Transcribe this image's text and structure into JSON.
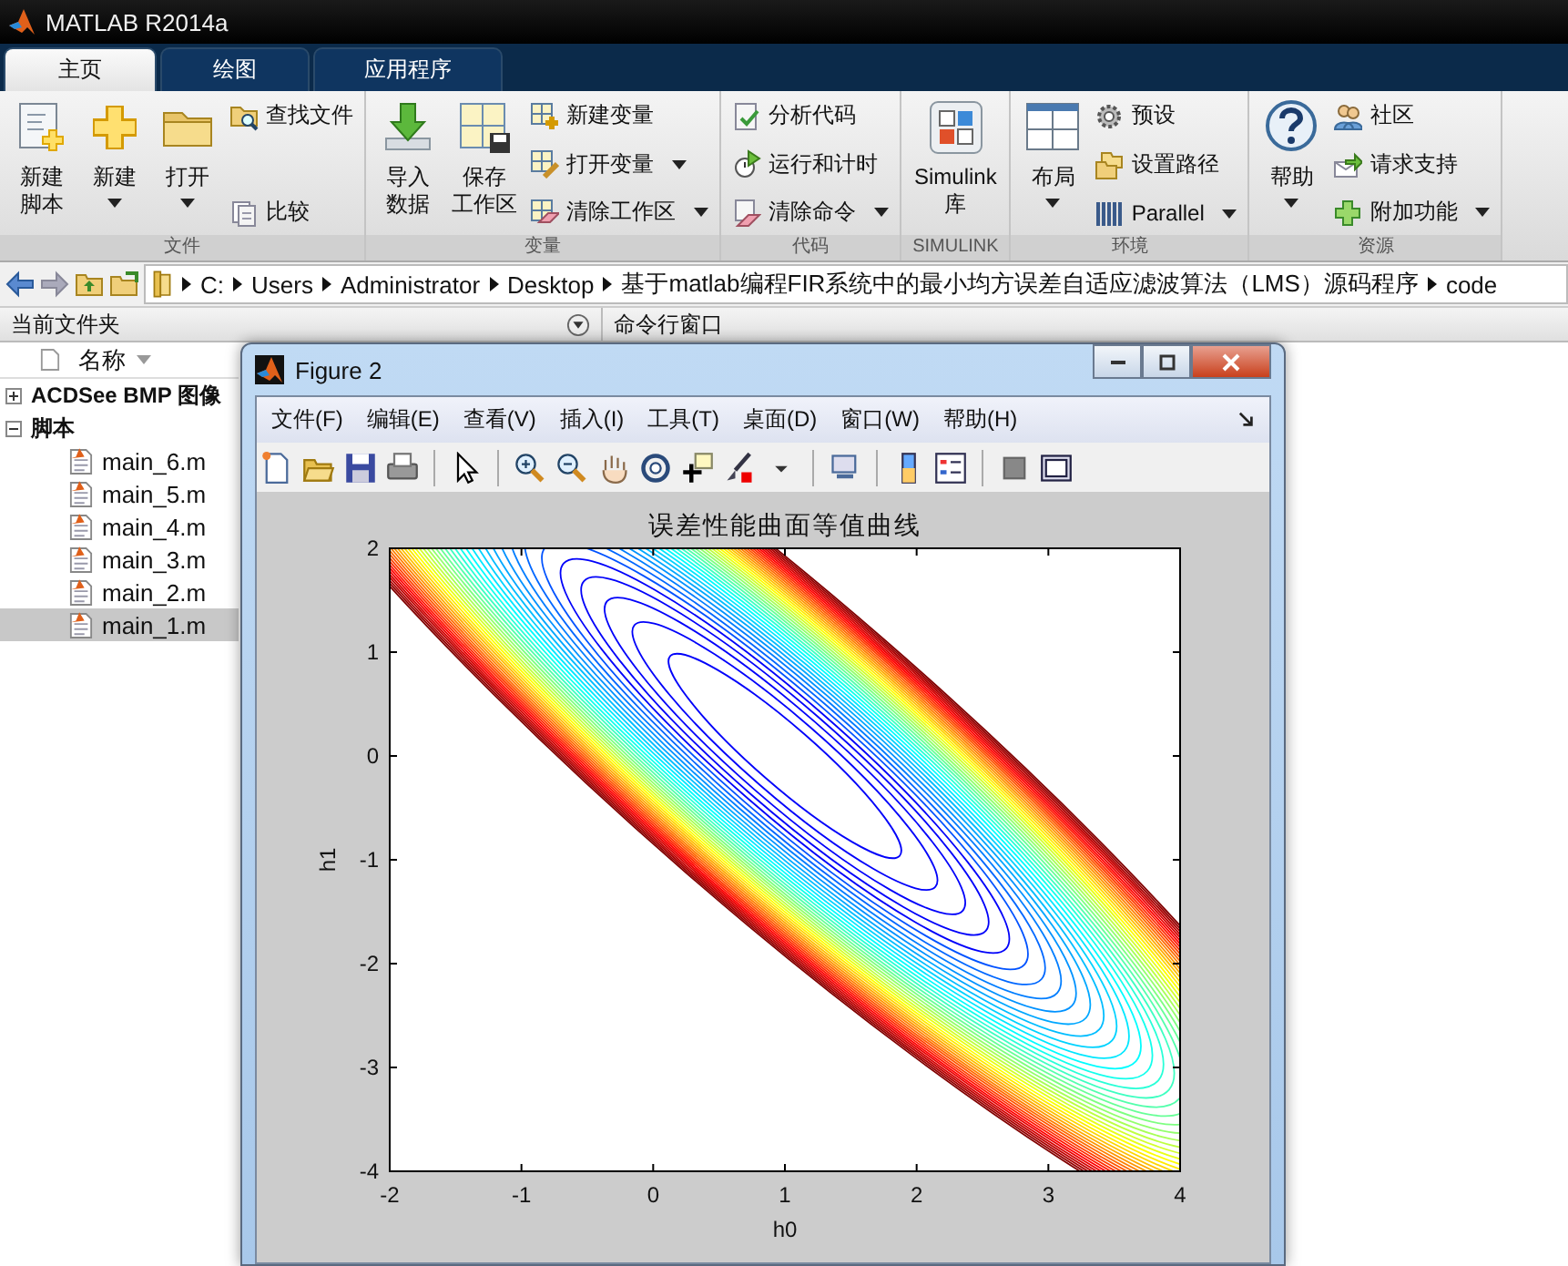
{
  "window": {
    "title": "MATLAB R2014a"
  },
  "tabs": [
    {
      "label": "主页",
      "selected": true
    },
    {
      "label": "绘图",
      "selected": false
    },
    {
      "label": "应用程序",
      "selected": false
    }
  ],
  "ribbon": {
    "groups": [
      {
        "label": "文件",
        "items": [
          {
            "kind": "large",
            "lines": [
              "新建",
              "脚本"
            ],
            "dropdown": false
          },
          {
            "kind": "large",
            "lines": [
              "新建"
            ],
            "dropdown": true
          },
          {
            "kind": "large",
            "lines": [
              "打开"
            ],
            "dropdown": true
          },
          {
            "kind": "small",
            "lines": [
              "查找文件"
            ],
            "dropdown": false
          },
          {
            "kind": "small",
            "lines": [
              "比较"
            ],
            "dropdown": false
          }
        ]
      },
      {
        "label": "变量",
        "items": [
          {
            "kind": "large",
            "lines": [
              "导入",
              "数据"
            ],
            "dropdown": false
          },
          {
            "kind": "large",
            "lines": [
              "保存",
              "工作区"
            ],
            "dropdown": false
          },
          {
            "kind": "small",
            "lines": [
              "新建变量"
            ],
            "dropdown": false
          },
          {
            "kind": "small",
            "lines": [
              "打开变量"
            ],
            "dropdown": true
          },
          {
            "kind": "small",
            "lines": [
              "清除工作区"
            ],
            "dropdown": true
          }
        ]
      },
      {
        "label": "代码",
        "items": [
          {
            "kind": "small",
            "lines": [
              "分析代码"
            ],
            "dropdown": false
          },
          {
            "kind": "small",
            "lines": [
              "运行和计时"
            ],
            "dropdown": false
          },
          {
            "kind": "small",
            "lines": [
              "清除命令"
            ],
            "dropdown": true
          }
        ]
      },
      {
        "label": "SIMULINK",
        "items": [
          {
            "kind": "large",
            "lines": [
              "Simulink",
              "库"
            ],
            "dropdown": false
          }
        ]
      },
      {
        "label": "环境",
        "items": [
          {
            "kind": "large",
            "lines": [
              "布局"
            ],
            "dropdown": true
          },
          {
            "kind": "small",
            "lines": [
              "预设"
            ],
            "dropdown": false
          },
          {
            "kind": "small",
            "lines": [
              "设置路径"
            ],
            "dropdown": false
          },
          {
            "kind": "small",
            "lines": [
              "Parallel"
            ],
            "dropdown": true
          }
        ]
      },
      {
        "label": "资源",
        "items": [
          {
            "kind": "large",
            "lines": [
              "帮助"
            ],
            "dropdown": true
          },
          {
            "kind": "small",
            "lines": [
              "社区"
            ],
            "dropdown": false
          },
          {
            "kind": "small",
            "lines": [
              "请求支持"
            ],
            "dropdown": false
          },
          {
            "kind": "small",
            "lines": [
              "附加功能"
            ],
            "dropdown": true
          }
        ]
      }
    ]
  },
  "address": {
    "segments": [
      "C:",
      "Users",
      "Administrator",
      "Desktop",
      "基于matlab编程FIR系统中的最小均方误差自适应滤波算法（LMS）源码程序",
      "code"
    ]
  },
  "current_folder": {
    "title": "当前文件夹",
    "column": "名称",
    "tree": [
      {
        "label": "ACDSee BMP 图像",
        "expanded": false,
        "selected": false
      },
      {
        "label": "脚本",
        "expanded": true,
        "selected": false,
        "children": [
          {
            "label": "main_6.m",
            "selected": false
          },
          {
            "label": "main_5.m",
            "selected": false
          },
          {
            "label": "main_4.m",
            "selected": false
          },
          {
            "label": "main_3.m",
            "selected": false
          },
          {
            "label": "main_2.m",
            "selected": false
          },
          {
            "label": "main_1.m",
            "selected": true
          }
        ]
      }
    ]
  },
  "command_window": {
    "title": "命令行窗口"
  },
  "figure": {
    "title": "Figure 2",
    "menu": [
      "文件(F)",
      "编辑(E)",
      "查看(V)",
      "插入(I)",
      "工具(T)",
      "桌面(D)",
      "窗口(W)",
      "帮助(H)"
    ],
    "plot": {
      "title": "误差性能曲面等值曲线",
      "xlabel": "h0",
      "ylabel": "h1",
      "xticks": [
        "-2",
        "-1",
        "0",
        "1",
        "2",
        "3",
        "4"
      ],
      "yticks": [
        "2",
        "1",
        "0",
        "-1",
        "-2",
        "-3",
        "-4"
      ]
    }
  }
}
